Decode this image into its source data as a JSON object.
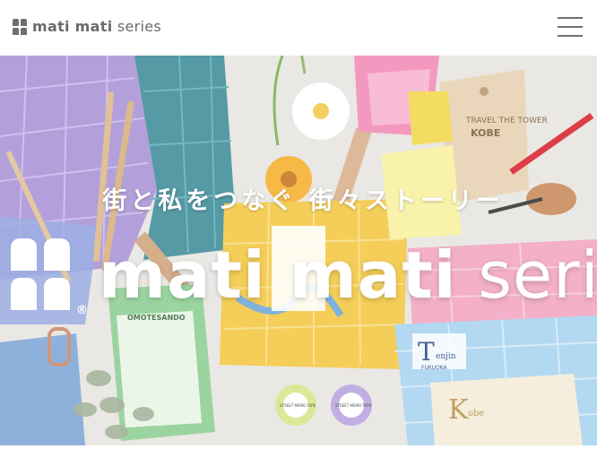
{
  "header": {
    "logo_bold": "mati mati",
    "logo_light": "series",
    "menu_icon": "hamburger-menu-icon"
  },
  "hero": {
    "tagline": "街と私をつなぐ 街々ストーリー",
    "brand_bold": "mati mati",
    "brand_light": "series",
    "registered": "®",
    "labels": {
      "tag_line1": "TRAVEL THE TOWER",
      "tag_line2": "KOBE",
      "note_omotesando": "OMOTESANDO",
      "tape1": "STREET MEMO TAPE",
      "tape2": "STREET MEMO TAPE",
      "tenjin_big": "T",
      "tenjin_small": "enjin",
      "tenjin_sub": "FUKUOKA",
      "kobe_big": "K",
      "kobe_small": "obe"
    }
  },
  "colors": {
    "logo_gray": "#6b6b6b",
    "menu_gray": "#707070",
    "hero_bg": "#e9e6e2"
  }
}
